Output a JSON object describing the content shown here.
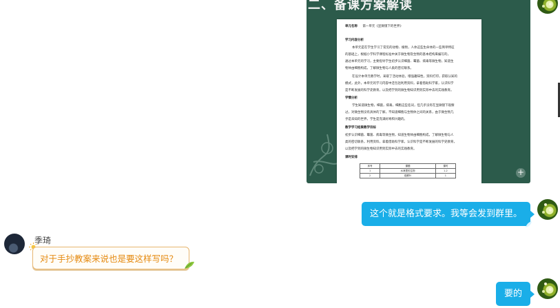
{
  "chat": {
    "image_message": {
      "slide_title": "二、备课方案解读",
      "document": {
        "unit_label": "单元名称",
        "unit_name": "第一单元《显微镜下的世界》",
        "section1": "学习内容分析",
        "p1a": "本单元是在学生学习了常见的动物、植物，人体这些生命体的一些简单特征",
        "p1b": "的基础上，根据小学科学课程标准中关于微生物及生物的基本结构来编写的，",
        "p1c": "通过本单元的学习，主要指导学生初步认识细菌、霉菌、病毒等微生物，知道生",
        "p1d": "物体由细胞构成，了解微生物与人类的密切联系。",
        "p2a": "在设计本单元教学时，采取了活动体验，增强趣味性，资料打印，获取认知的",
        "p2b": "模式，此外，本单元的学习内容中还包括利用资料，拿着借助科学家，认识科学",
        "p2c": "是不断发展的科学史教育，以及把学到的微生物知识用到实际中去的实践教育。",
        "section2": "学情分析",
        "p3a": "学生知道微生物，细菌，病毒，细胞这些名词，但几乎没有在显微镜下观察",
        "p3b": "过，对微生物没有具体的了解，不知道细胞与生物体之间的关系，由于微生物几",
        "p3c": "乎是未知的世界，学生是充满好奇和兴趣的。",
        "section3": "教学学习结果教学目标",
        "p4a": "初步认识细菌、霉菌、病毒等微生物，知道生物体由细胞构成，了解微生物与人",
        "p4b": "类的密切联系，利用资料，拿着借助科学家，认识科学是不断发展的科学史教育，",
        "p4c": "以及把学到的微生物知识用到实际中去的实践教育。",
        "section4": "课时安排",
        "table_rows": [
          [
            "序号",
            "课题",
            "课时"
          ],
          [
            "1",
            "水滴里的生物",
            "1-2"
          ],
          [
            "2",
            "观察叶",
            "1"
          ]
        ]
      },
      "zoom_icon_label": "+"
    },
    "messages": [
      {
        "sender": "self",
        "text": "这个就是格式要求。我等会发到群里。"
      },
      {
        "sender": "季琦",
        "text": "对于手抄教案来说也是要这样写吗？"
      },
      {
        "sender": "self",
        "text": "要的"
      }
    ]
  },
  "colors": {
    "self_bubble": "#1aaee8",
    "other_bubble_border": "#e7b56f",
    "other_text": "#e58a10",
    "slide_bg": "#2c5b4b"
  }
}
